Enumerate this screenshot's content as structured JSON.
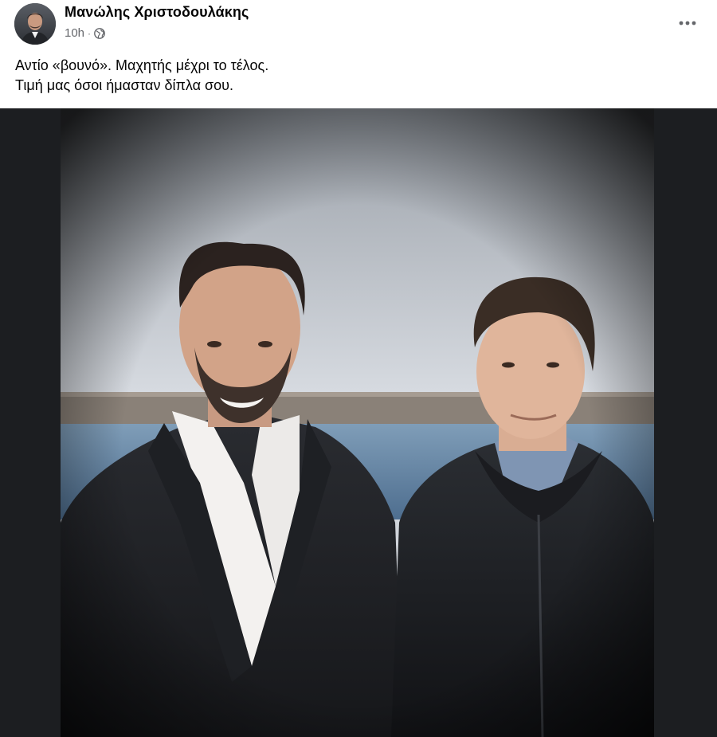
{
  "post": {
    "author": "Μανώλης Χριστοδουλάκης",
    "timestamp": "10h",
    "separator": "·",
    "privacy_icon": "globe-icon",
    "more_icon": "more-horizontal-icon",
    "caption_lines": [
      "Αντίο «βουνό». Μαχητής μέχρι το τέλος.",
      "Τιμή μας όσοι ήμασταν δίπλα σου."
    ]
  },
  "colors": {
    "text_primary": "#050505",
    "text_secondary": "#65676b",
    "photo_background": "#1c1e21"
  }
}
